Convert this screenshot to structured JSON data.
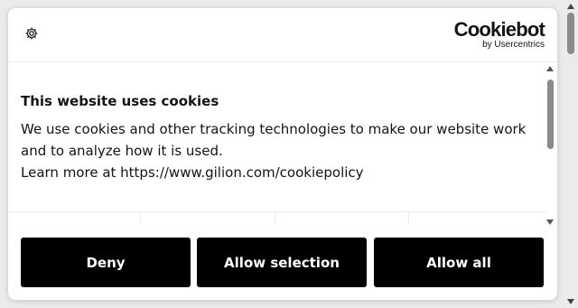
{
  "header": {
    "settings_icon": "gear-icon",
    "brand_name": "Cookiebot",
    "brand_sub": "by Usercentrics"
  },
  "content": {
    "title": "This website uses cookies",
    "body_lines": [
      "We use cookies and other tracking technologies to make our website work",
      "and to analyze how it is used.",
      "Learn more at https://www.gilion.com/cookiepolicy"
    ]
  },
  "actions": {
    "deny_label": "Deny",
    "allow_selection_label": "Allow selection",
    "allow_all_label": "Allow all"
  },
  "colors": {
    "button_bg": "#000000",
    "button_text": "#ffffff",
    "text": "#141414",
    "background": "#ebebeb"
  }
}
